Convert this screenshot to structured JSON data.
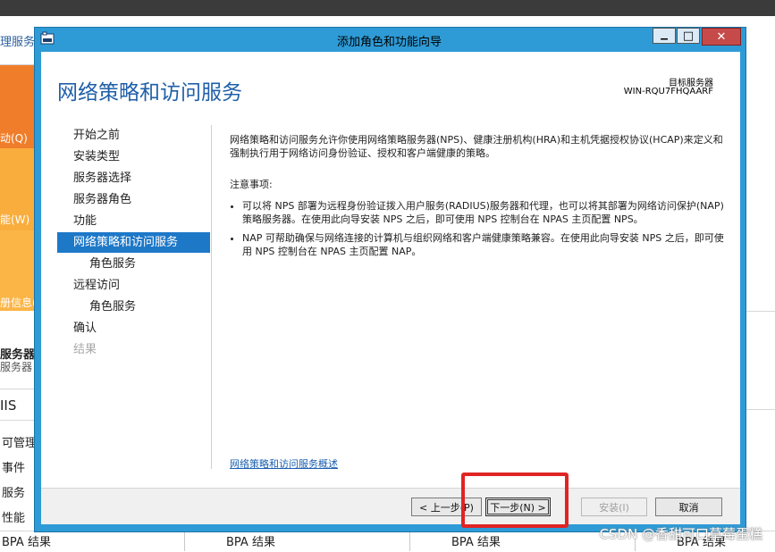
{
  "background": {
    "header_title": "理服务",
    "tile_texts": [
      "动(Q)",
      "能(W)",
      "册信息("
    ],
    "section_title": "服务器",
    "section_sub": "服务器",
    "iis_label": "IIS",
    "list_items": [
      "可管理",
      "事件",
      "服务",
      "性能"
    ],
    "bpa_labels": [
      "BPA 结果",
      "BPA 结果",
      "BPA 结果",
      "BPA 结果"
    ]
  },
  "watermark": "CSDN @香甜可口草莓蛋糕",
  "window": {
    "title": "添加角色和功能向导",
    "minimize_glyph": "▁",
    "maximize_glyph": "□",
    "close_glyph": "✕"
  },
  "page": {
    "title": "网络策略和访问服务",
    "target_label": "目标服务器",
    "target_server": "WIN-RQU7FHQAARF"
  },
  "nav": [
    {
      "label": "开始之前",
      "state": "normal",
      "level": 0
    },
    {
      "label": "安装类型",
      "state": "normal",
      "level": 0
    },
    {
      "label": "服务器选择",
      "state": "normal",
      "level": 0
    },
    {
      "label": "服务器角色",
      "state": "normal",
      "level": 0
    },
    {
      "label": "功能",
      "state": "normal",
      "level": 0
    },
    {
      "label": "网络策略和访问服务",
      "state": "active",
      "level": 0
    },
    {
      "label": "角色服务",
      "state": "normal",
      "level": 1
    },
    {
      "label": "远程访问",
      "state": "normal",
      "level": 0
    },
    {
      "label": "角色服务",
      "state": "normal",
      "level": 1
    },
    {
      "label": "确认",
      "state": "normal",
      "level": 0
    },
    {
      "label": "结果",
      "state": "disabled",
      "level": 0
    }
  ],
  "content": {
    "intro": "网络策略和访问服务允许你使用网络策略服务器(NPS)、健康注册机构(HRA)和主机凭据授权协议(HCAP)来定义和强制执行用于网络访问身份验证、授权和客户端健康的策略。",
    "notes_heading": "注意事项:",
    "notes": [
      "可以将 NPS 部署为远程身份验证拨入用户服务(RADIUS)服务器和代理，也可以将其部署为网络访问保护(NAP)策略服务器。在使用此向导安装 NPS 之后，即可使用 NPS 控制台在 NPAS 主页配置 NPS。",
      "NAP 可帮助确保与网络连接的计算机与组织网络和客户端健康策略兼容。在使用此向导安装 NPS 之后，即可使用 NPS 控制台在 NPAS 主页配置 NAP。"
    ],
    "more_link": "网络策略和访问服务概述"
  },
  "buttons": {
    "prev": "< 上一步(P)",
    "next": "下一步(N) >",
    "install": "安装(I)",
    "cancel": "取消"
  },
  "colors": {
    "window_border": "#2e9bd6",
    "nav_active": "#1e78c8",
    "title_blue": "#1f5fa8",
    "highlight_red": "#e02424"
  }
}
